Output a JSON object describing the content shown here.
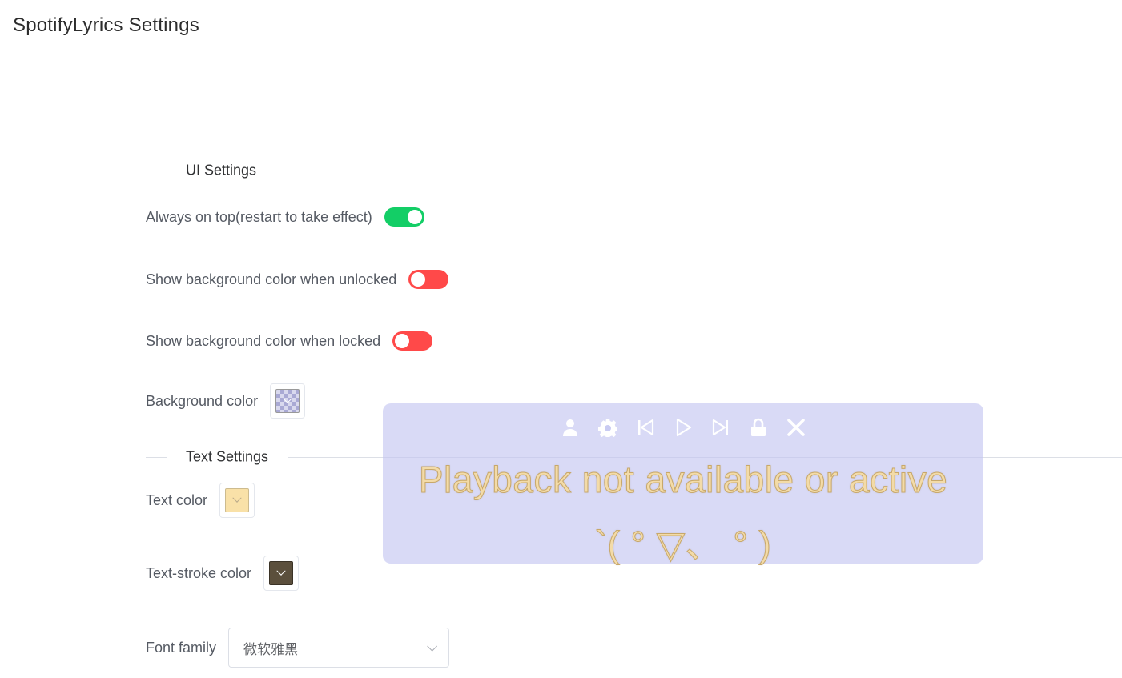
{
  "window": {
    "title": "SpotifyLyrics Settings"
  },
  "ui_settings": {
    "section_title": "UI Settings",
    "always_on_top": {
      "label": "Always on top(restart to take effect)",
      "value": true
    },
    "bg_unlocked": {
      "label": "Show background color when unlocked",
      "value": false
    },
    "bg_locked": {
      "label": "Show background color when locked",
      "value": false
    },
    "background_color": {
      "label": "Background color",
      "value": "#b4b4e6"
    }
  },
  "text_settings": {
    "section_title": "Text Settings",
    "text_color": {
      "label": "Text color",
      "value": "#f9e1a8"
    },
    "stroke_color": {
      "label": "Text-stroke color",
      "value": "#5b4f3c"
    },
    "font_family": {
      "label": "Font family",
      "value": "微软雅黑"
    }
  },
  "lyrics_overlay": {
    "line1": "Playback not available or active",
    "line2": "`( ° ▽、 ° )",
    "toolbar_icons": [
      "user-icon",
      "gear-icon",
      "previous-track-icon",
      "play-icon",
      "next-track-icon",
      "lock-icon",
      "close-icon"
    ]
  },
  "colors": {
    "switch_on": "#13ce66",
    "switch_off": "#ff4949",
    "overlay_bg": "#c1c4f0",
    "lyric_fill": "#f3dba8"
  }
}
